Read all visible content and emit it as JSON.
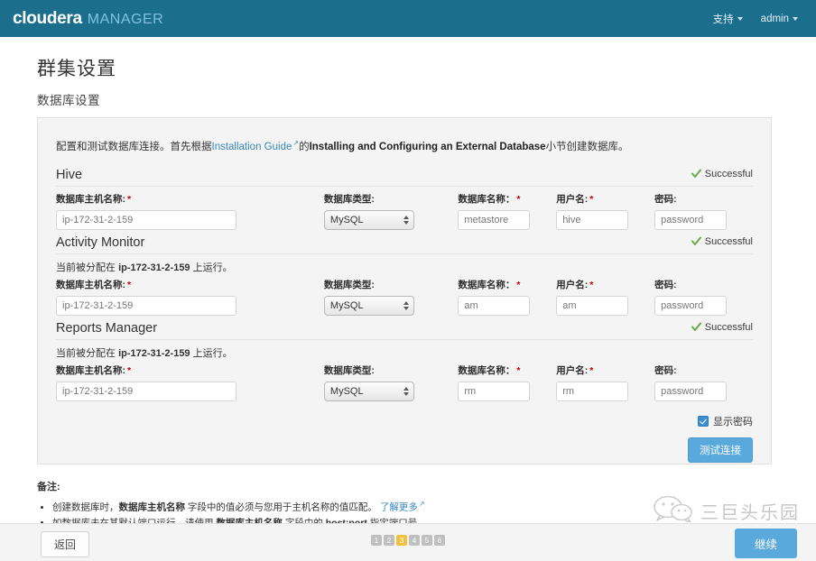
{
  "topbar": {
    "brand_main": "cloudera",
    "brand_sub": "MANAGER",
    "support_label": "支持",
    "user_label": "admin"
  },
  "page": {
    "title": "群集设置",
    "subtitle": "数据库设置"
  },
  "panel": {
    "desc_prefix": "配置和测试数据库连接。首先根据",
    "desc_link": "Installation Guide",
    "desc_mid": "的",
    "desc_bold": "Installing and Configuring an External Database",
    "desc_suffix": "小节创建数据库。"
  },
  "labels": {
    "host": "数据库主机名称:",
    "type": "数据库类型:",
    "dbname": "数据库名称：",
    "user": "用户名:",
    "password": "密码:",
    "required_mark": "*",
    "status_ok": "Successful"
  },
  "sections": [
    {
      "name": "Hive",
      "status": "Successful",
      "note": "",
      "host": "ip-172-31-2-159",
      "type": "MySQL",
      "dbname": "metastore",
      "user": "hive",
      "password": "password"
    },
    {
      "name": "Activity Monitor",
      "status": "Successful",
      "note_prefix": "当前被分配在 ",
      "note_host": "ip-172-31-2-159",
      "note_suffix": " 上运行。",
      "host": "ip-172-31-2-159",
      "type": "MySQL",
      "dbname": "am",
      "user": "am",
      "password": "password"
    },
    {
      "name": "Reports Manager",
      "status": "Successful",
      "note_prefix": "当前被分配在 ",
      "note_host": "ip-172-31-2-159",
      "note_suffix": " 上运行。",
      "host": "ip-172-31-2-159",
      "type": "MySQL",
      "dbname": "rm",
      "user": "rm",
      "password": "password"
    }
  ],
  "controls": {
    "show_password_label": "显示密码",
    "show_password_checked": true,
    "test_connection_label": "测试连接"
  },
  "notes": {
    "title": "备注:",
    "item1_a": "创建数据库时，",
    "item1_b": "数据库主机名称",
    "item1_c": " 字段中的值必须与您用于主机名称的值匹配。 ",
    "item1_link": "了解更多",
    "item2_a": "如数据库未在其默认端口运行，请使用 ",
    "item2_b": "数据库主机名称",
    "item2_c": " 字段中的 ",
    "item2_d": "host:port",
    "item2_e": " 指定端口号。"
  },
  "footer": {
    "back_label": "返回",
    "next_label": "继续",
    "pages": [
      "1",
      "2",
      "3",
      "4",
      "5",
      "6"
    ],
    "active_page": "3"
  },
  "watermark": {
    "text": "三巨头乐园"
  },
  "colors": {
    "header_bg": "#1b6e8c",
    "accent_blue": "#5aa9dd",
    "link_blue": "#3a87bd",
    "success_green": "#6aa84f",
    "active_step": "#f0c040",
    "required_red": "#cc0000"
  }
}
